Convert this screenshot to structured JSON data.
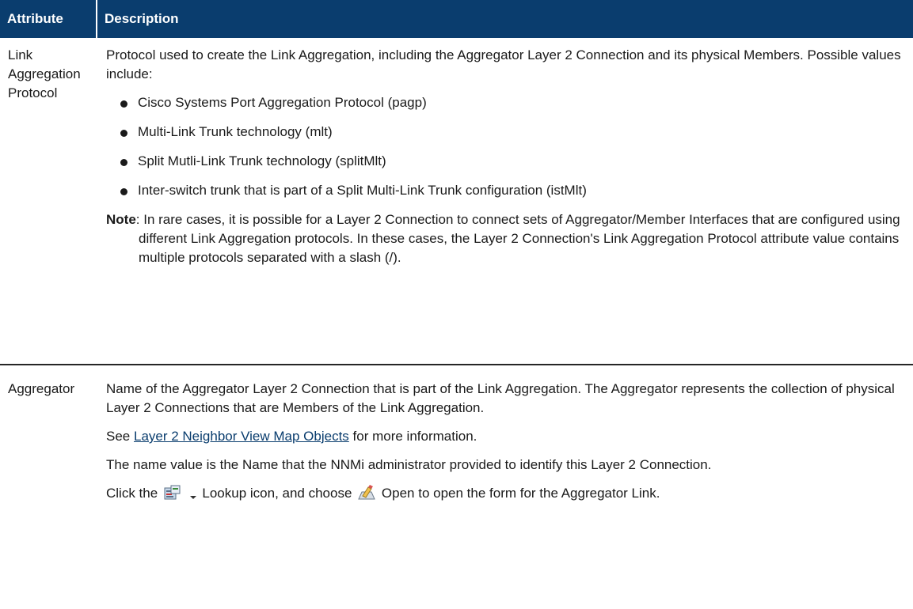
{
  "table": {
    "headers": {
      "attribute": "Attribute",
      "description": "Description"
    },
    "rows": [
      {
        "attribute": "Link Aggregation Protocol",
        "intro": "Protocol used to create the Link Aggregation, including the Aggregator Layer 2 Connection and its physical Members. Possible values include:",
        "values": [
          "Cisco Systems Port Aggregation Protocol (pagp)",
          "Multi-Link Trunk technology (mlt)",
          "Split Mutli-Link Trunk technology (splitMlt)",
          "Inter-switch trunk that is part of a Split Multi-Link Trunk configuration (istMlt)"
        ],
        "note_label": "Note",
        "note_text": ": In rare cases, it is possible for a Layer 2 Connection to connect sets of Aggregator/Member Interfaces that are configured using different Link Aggregation protocols. In these cases, the Layer 2 Connection's Link Aggregation Protocol attribute value contains multiple protocols separated with a slash (/)."
      },
      {
        "attribute": "Aggregator",
        "desc1": "Name of the Aggregator Layer 2 Connection that is part of the Link Aggregation. The Aggregator represents the collection of physical Layer 2 Connections that are Members of the Link Aggregation.",
        "see_prefix": "See ",
        "see_link": "Layer 2 Neighbor View Map Objects",
        "see_suffix": " for more information.",
        "desc3": "The name value is the Name that the NNMi administrator provided to identify this Layer 2 Connection.",
        "click_prefix": "Click the",
        "lookup_text": "Lookup icon, and choose",
        "open_text": "Open to open the form for the Aggregator Link."
      }
    ]
  },
  "icons": {
    "lookup": "lookup-icon",
    "dropdown": "dropdown-arrow-icon",
    "open": "open-form-icon"
  }
}
